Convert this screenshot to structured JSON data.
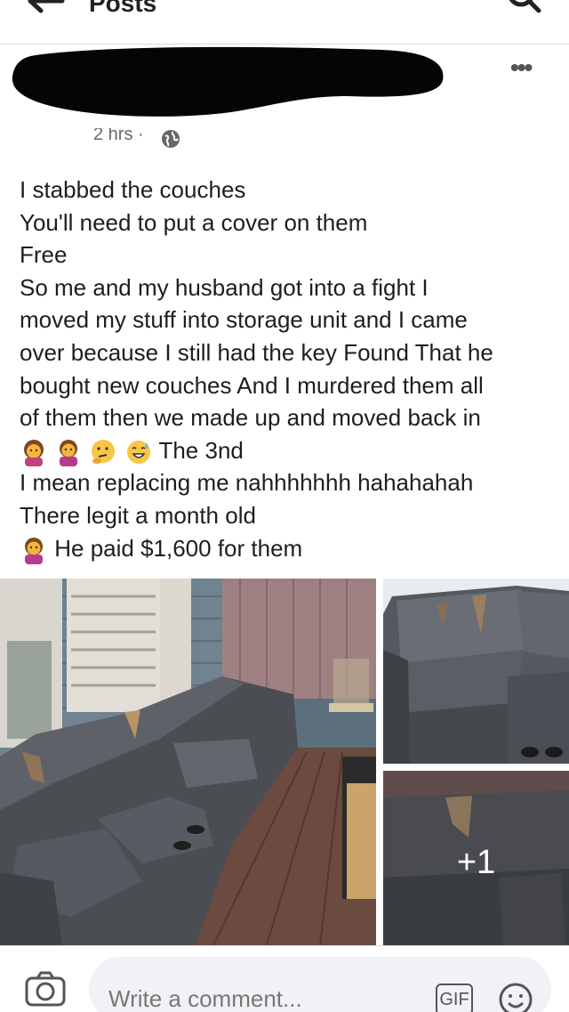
{
  "topbar": {
    "title": "Posts",
    "back_icon": "arrow-left-icon",
    "search_icon": "search-icon"
  },
  "post": {
    "timestamp": "2 hrs ·",
    "globe_icon": "globe-icon",
    "more_icon": "more-icon",
    "more_glyph": "•••",
    "lines": [
      "I stabbed the couches",
      "You'll need to put a cover on them",
      "Free",
      " So me and my husband got into a fight I",
      "moved my stuff into storage unit and I came",
      "over because I still had the key Found  That he",
      "bought new couches And I murdered them all",
      "of them then we made up and moved back in"
    ],
    "emoji_line_text": " The 3nd",
    "lines_after": [
      "I mean replacing me nahhhhhhh hahahahah",
      "There legit a month old"
    ],
    "last_line_text": " He paid $1,600 for them"
  },
  "photos": {
    "more_count": "+1"
  },
  "comment_bar": {
    "placeholder": "Write a comment...",
    "gif_label": "GIF"
  },
  "colors": {
    "text": "#1c1e21",
    "muted": "#65676b",
    "input_bg": "#f0f2f5"
  }
}
